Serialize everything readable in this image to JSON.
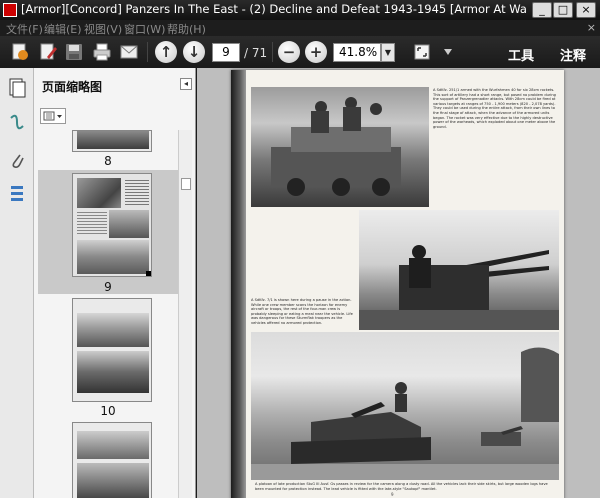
{
  "window": {
    "title": "[Armor][Concord] Panzers In The East - (2) Decline and Defeat 1943-1945 [Armor At War Series] [WWII]...",
    "controls": [
      "_",
      "□",
      "×"
    ]
  },
  "menu": {
    "items": [
      "文件(F)",
      "编辑(E)",
      "视图(V)",
      "窗口(W)",
      "帮助(H)"
    ],
    "close": "×"
  },
  "toolbar": {
    "page_current": "9",
    "page_total": "/ 71",
    "zoom": "41.8%",
    "tools_label": "工具",
    "notes_label": "注释"
  },
  "panel": {
    "title": "页面缩略图",
    "collapse": "◂",
    "thumbnails": [
      {
        "label": "8",
        "selected": false
      },
      {
        "label": "9",
        "selected": true
      },
      {
        "label": "10",
        "selected": false
      },
      {
        "label": "",
        "selected": false
      }
    ]
  },
  "document": {
    "caption_top": "A SdKfz. 251/1 armed with the Wurfahmen 40 for six 28cm rockets. This sort of artillery had a short range, but posed no problem during the support of Panzergrenadier attacks. With 28cm could be fired at various targets at ranges of 750 - 1,900 meters (820 - 2,078 yards). They could be used during the entire attack, from their own lines to the final stage of attack, when the advance of the armored units began. The rocket was very effective due to the highly destructive power of the warheads, which exploded about one meter above the ground.",
    "caption_mid": "A SdKfz. 7/1 is shown here during a pause in the action. While one crew member scans the horizon for enemy aircraft or troops, the rest of the four-man crew is probably sleeping or eating a meal near the vehicle. Life was dangerous for these Sturmflak troopers as the vehicles offered no armored protection.",
    "caption_bottom": "A platoon of late production StuG III Ausf. Gs passes in review for the camera along a dusty road. All the vehicles lack their side skirts, but large wooden logs have been mounted for protection instead. The lead vehicle is fitted with the late-style \"Saukopf\" mantlet.",
    "folio": "9"
  }
}
